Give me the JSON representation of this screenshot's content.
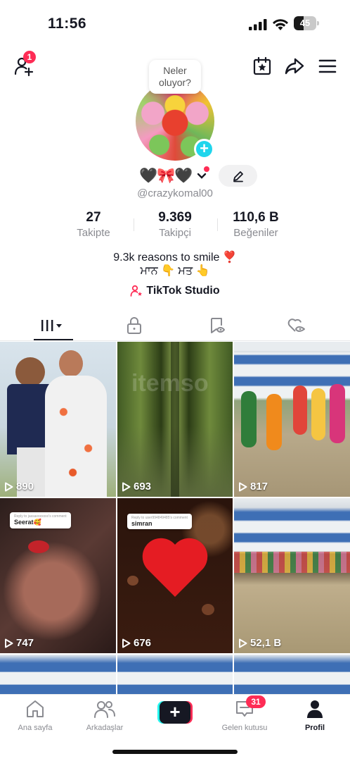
{
  "status_bar": {
    "time": "11:56",
    "battery": "45",
    "battery_level": 0.45
  },
  "header": {
    "friend_requests_badge": "1",
    "status_bubble": "Neler oluyor?"
  },
  "profile": {
    "name_emoji": "🖤🎀🖤",
    "handle": "@crazykomal00",
    "stats": [
      {
        "value": "27",
        "label": "Takipte"
      },
      {
        "value": "9.369",
        "label": "Takipçi"
      },
      {
        "value": "110,6 B",
        "label": "Beğeniler"
      }
    ],
    "bio_line1": "9.3k reasons to smile ❣️",
    "bio_line2": "ਮਾਨ 👇 ਮਤ 👆",
    "studio_label": "TikTok Studio"
  },
  "tabs": [
    "videos-icon",
    "lock-icon",
    "saved-icon",
    "liked-icon"
  ],
  "videos": [
    {
      "views": "890"
    },
    {
      "views": "693"
    },
    {
      "views": "817"
    },
    {
      "views": "747",
      "reply_to": "Reply to jassaxoxxxxx's comment",
      "reply_name": "Seerat🥰"
    },
    {
      "views": "676",
      "reply_to": "Reply to user994849485's comment",
      "reply_name": "simran"
    },
    {
      "views": "52,1 B"
    }
  ],
  "watermark": "itemso",
  "bottom_nav": {
    "home": "Ana sayfa",
    "friends": "Arkadaşlar",
    "inbox": "Gelen kutusu",
    "inbox_badge": "31",
    "profile": "Profil"
  },
  "colors": {
    "accent": "#fe2c55",
    "cyan": "#20d5ec",
    "text": "#161823",
    "secondary": "#8a8b91"
  }
}
